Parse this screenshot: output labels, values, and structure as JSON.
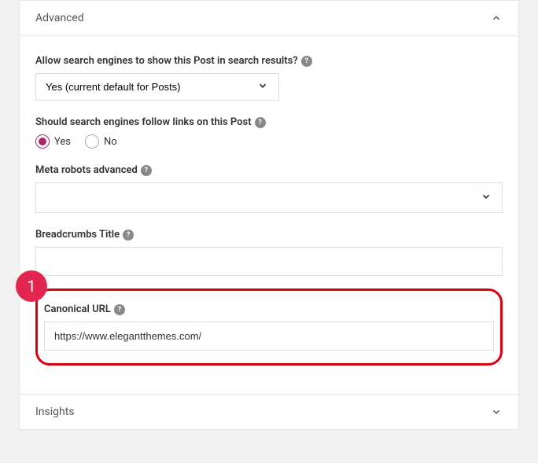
{
  "section": {
    "title": "Advanced"
  },
  "fields": {
    "search_results": {
      "label": "Allow search engines to show this Post in search results?",
      "value": "Yes (current default for Posts)"
    },
    "follow_links": {
      "label": "Should search engines follow links on this Post",
      "options": {
        "yes": "Yes",
        "no": "No"
      }
    },
    "meta_robots": {
      "label": "Meta robots advanced",
      "value": ""
    },
    "breadcrumbs": {
      "label": "Breadcrumbs Title",
      "value": ""
    },
    "canonical": {
      "label": "Canonical URL",
      "value": "https://www.elegantthemes.com/"
    }
  },
  "insights": {
    "title": "Insights"
  },
  "annotation": {
    "number": "1"
  }
}
